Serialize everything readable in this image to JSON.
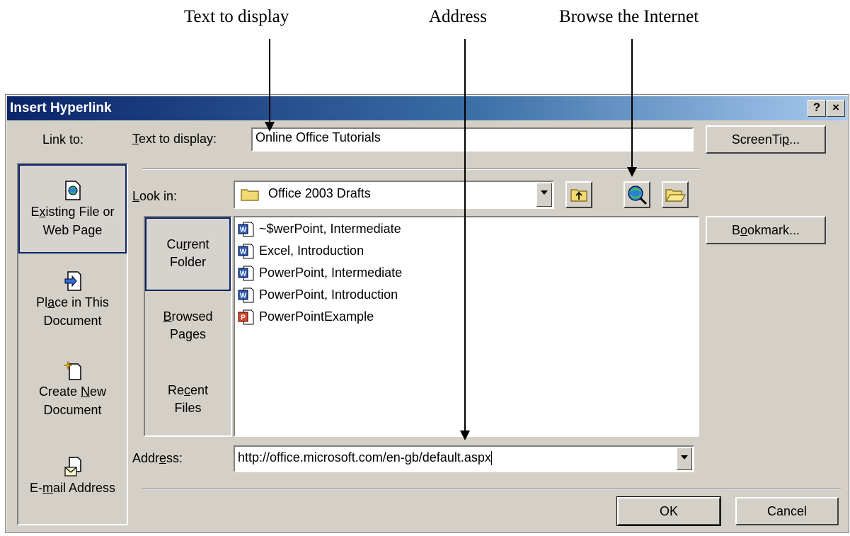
{
  "annotations": {
    "text_to_display": "Text to display",
    "address": "Address",
    "browse": "Browse the Internet"
  },
  "dialog": {
    "title": "Insert Hyperlink",
    "help_btn": "?",
    "close_btn": "×"
  },
  "link_to": {
    "label": "Link to:",
    "items": [
      {
        "line1_pre": "E",
        "line1_u": "x",
        "line1_post": "isting File or",
        "line2": "Web Page"
      },
      {
        "line1_pre": "Pl",
        "line1_u": "a",
        "line1_post": "ce in This",
        "line2": "Document"
      },
      {
        "line1_pre": "Create ",
        "line1_u": "N",
        "line1_post": "ew",
        "line2": "Document"
      },
      {
        "line1_pre": "E-",
        "line1_u": "m",
        "line1_post": "ail Address"
      }
    ]
  },
  "text_to_display": {
    "label_u": "T",
    "label_rest": "ext to display:",
    "value": "Online Office Tutorials"
  },
  "screentip": {
    "pre": "ScreenTi",
    "u": "p",
    "post": "..."
  },
  "look_in": {
    "label_u": "L",
    "label_rest": "ook in:",
    "value": "Office 2003 Drafts"
  },
  "nav": {
    "items": [
      {
        "line1_pre": "Cu",
        "line1_u": "r",
        "line1_post": "rent",
        "line2": "Folder"
      },
      {
        "line1_pre": "",
        "line1_u": "B",
        "line1_post": "rowsed",
        "line2": "Pages"
      },
      {
        "line1_pre": "Re",
        "line1_u": "c",
        "line1_post": "ent",
        "line2": "Files"
      }
    ]
  },
  "files": [
    {
      "name": "~$werPoint, Intermediate",
      "type": "word"
    },
    {
      "name": "Excel, Introduction",
      "type": "word"
    },
    {
      "name": "PowerPoint, Intermediate",
      "type": "word"
    },
    {
      "name": "PowerPoint, Introduction",
      "type": "word"
    },
    {
      "name": "PowerPointExample",
      "type": "powerpoint"
    }
  ],
  "bookmark": {
    "pre": "B",
    "u": "o",
    "post": "okmark..."
  },
  "address": {
    "label_pre": "Addr",
    "label_u": "e",
    "label_post": "ss:",
    "value": "http://office.microsoft.com/en-gb/default.aspx"
  },
  "ok": "OK",
  "cancel": "Cancel"
}
